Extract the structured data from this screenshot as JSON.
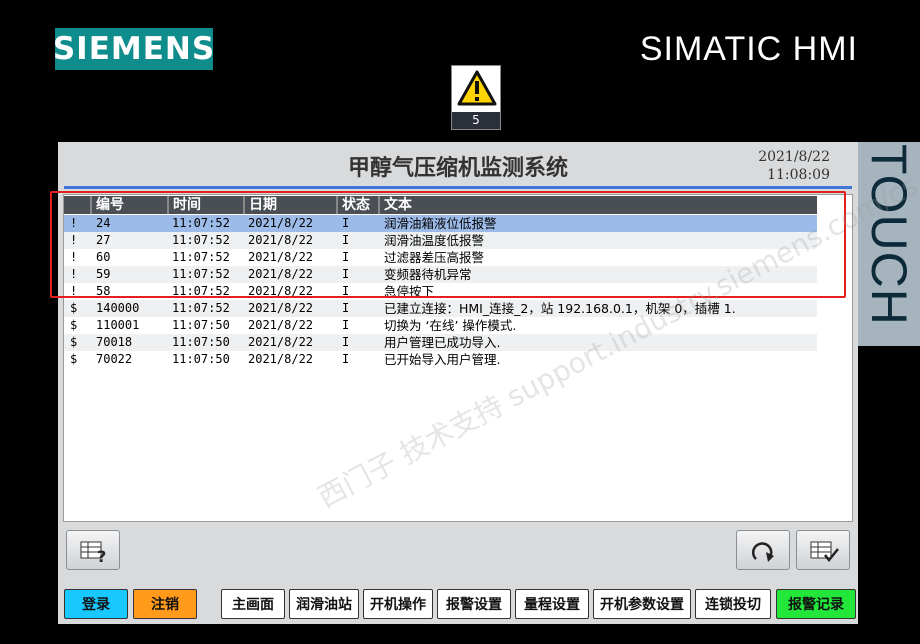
{
  "header": {
    "logo": "SIEMENS",
    "brand": "SIMATIC HMI",
    "alarm_count": "5",
    "side_label": "TOUCH"
  },
  "screen": {
    "title": "甲醇气压缩机监测系统",
    "date": "2021/8/22",
    "time": "11:08:09"
  },
  "alarm_table": {
    "columns": [
      "编号",
      "时间",
      "日期",
      "状态",
      "文本"
    ],
    "rows": [
      {
        "type": "!",
        "id": "24",
        "time": "11:07:52",
        "date": "2021/8/22",
        "state": "I",
        "text": "润滑油箱液位低报警",
        "selected": true
      },
      {
        "type": "!",
        "id": "27",
        "time": "11:07:52",
        "date": "2021/8/22",
        "state": "I",
        "text": "润滑油温度低报警"
      },
      {
        "type": "!",
        "id": "60",
        "time": "11:07:52",
        "date": "2021/8/22",
        "state": "I",
        "text": "过滤器差压高报警"
      },
      {
        "type": "!",
        "id": "59",
        "time": "11:07:52",
        "date": "2021/8/22",
        "state": "I",
        "text": "变频器待机异常"
      },
      {
        "type": "!",
        "id": "58",
        "time": "11:07:52",
        "date": "2021/8/22",
        "state": "I",
        "text": "急停按下"
      },
      {
        "type": "$",
        "id": "140000",
        "time": "11:07:52",
        "date": "2021/8/22",
        "state": "I",
        "text": "已建立连接：HMI_连接_2，站 192.168.0.1，机架 0，插槽 1."
      },
      {
        "type": "$",
        "id": "110001",
        "time": "11:07:50",
        "date": "2021/8/22",
        "state": "I",
        "text": "切换为 ‘在线’ 操作模式."
      },
      {
        "type": "$",
        "id": "70018",
        "time": "11:07:50",
        "date": "2021/8/22",
        "state": "I",
        "text": "用户管理已成功导入."
      },
      {
        "type": "$",
        "id": "70022",
        "time": "11:07:50",
        "date": "2021/8/22",
        "state": "I",
        "text": "已开始导入用户管理."
      }
    ]
  },
  "watermark": "西门子 技术支持 support.industry.siemens.com/cs",
  "nav": {
    "login": "登录",
    "logout": "注销",
    "items": [
      "主画面",
      "润滑油站",
      "开机操作",
      "报警设置",
      "量程设置",
      "开机参数设置",
      "连锁投切",
      "报警记录"
    ]
  },
  "colors": {
    "login": "#19c8ff",
    "logout": "#ff9a1a",
    "active_nav": "#22e63a",
    "selected_row": "#9dbbe8",
    "header_blue": "#3e77d8"
  }
}
